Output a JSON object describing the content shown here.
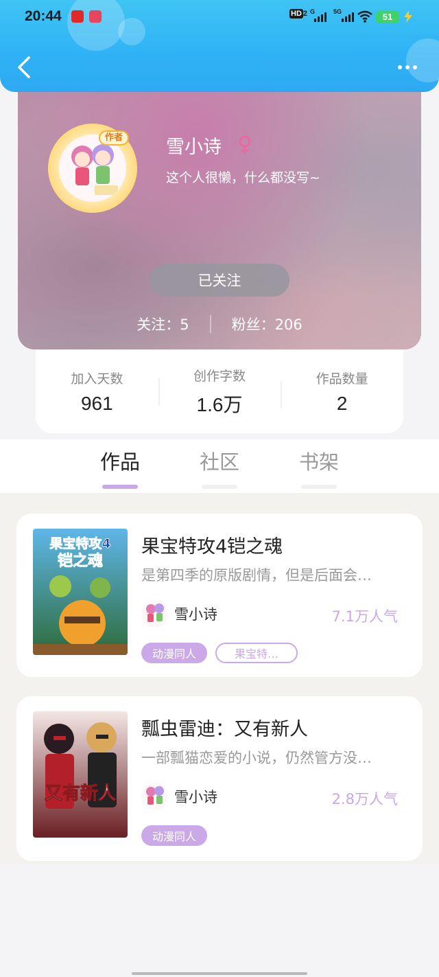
{
  "status_bar": {
    "time": "20:44",
    "network_hd": "HD",
    "network_hd_sub": "2",
    "network_g": "G",
    "network_5g": "5G",
    "battery": "51"
  },
  "profile": {
    "author_badge": "作者",
    "username": "雪小诗",
    "bio": "这个人很懒，什么都没写~",
    "follow_button": "已关注",
    "following_label": "关注：5",
    "fans_label": "粉丝：206"
  },
  "stats": [
    {
      "label": "加入天数",
      "value": "961"
    },
    {
      "label": "创作字数",
      "value": "1.6万"
    },
    {
      "label": "作品数量",
      "value": "2"
    }
  ],
  "tabs": [
    {
      "label": "作品",
      "active": true
    },
    {
      "label": "社区",
      "active": false
    },
    {
      "label": "书架",
      "active": false
    }
  ],
  "works": [
    {
      "cover_text_line1": "果宝特攻4",
      "cover_text_line2": "铠之魂",
      "title": "果宝特攻4铠之魂",
      "description": "是第四季的原版剧情，但是后面会…",
      "author": "雪小诗",
      "popularity": "7.1万人气",
      "tags": [
        "动漫同人",
        "果宝特…"
      ]
    },
    {
      "cover_text_line1": "又有新人",
      "title": "瓢虫雷迪：又有新人",
      "description": "一部瓢猫恋爱的小说，仍然管方没…",
      "author": "雪小诗",
      "popularity": "2.8万人气",
      "tags": [
        "动漫同人"
      ]
    }
  ],
  "colors": {
    "header": "#2fb2f5",
    "accent": "#c9a7e8",
    "tag_fill": "#cba9e8"
  }
}
